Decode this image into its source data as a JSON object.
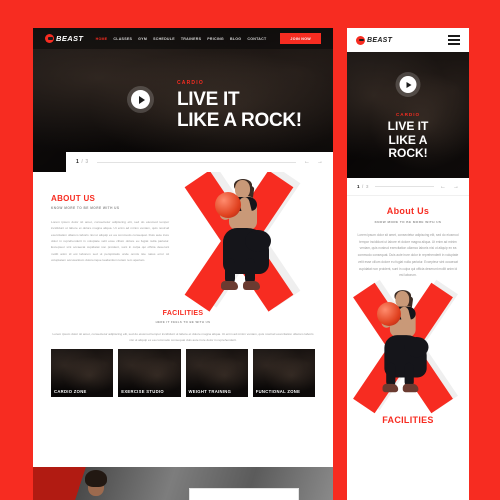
{
  "page": {
    "background_color": "#f72c21",
    "accent_color": "#f72c21",
    "brand": "BEAST"
  },
  "desktop": {
    "header": {
      "logo_text": "BEAST",
      "nav_items": [
        {
          "label": "HOME",
          "active": true
        },
        {
          "label": "CLASSES",
          "active": false
        },
        {
          "label": "GYM",
          "active": false
        },
        {
          "label": "SCHEDULE",
          "active": false
        },
        {
          "label": "TRAINERS",
          "active": false
        },
        {
          "label": "PRICING",
          "active": false
        },
        {
          "label": "BLOG",
          "active": false
        },
        {
          "label": "CONTACT",
          "active": false
        }
      ],
      "cta_label": "JOIN NOW"
    },
    "hero": {
      "kicker": "CARDIO",
      "headline_line1": "LIVE IT",
      "headline_line2": "LIKE A ROCK!",
      "play_icon": "play-icon"
    },
    "slider": {
      "current": "1",
      "separator": "/",
      "total": "3",
      "prev_icon": "arrow-left-icon",
      "next_icon": "arrow-right-icon"
    },
    "about": {
      "title": "ABOUT US",
      "subtitle": "KNOW MORE TO BE MORE WITH US",
      "body": "Lorem ipsum dolor sit amet, consectetur adipiscing elit, sed do eiusmod tempor incididunt ut labore et dolore magna aliqua. Ut enim ad minim veniam, quis nostrud exercitation ullamco laboris nisi ut aliquip ex ea commodo consequat. Duis aute irure dolor in reprehenderit in voluptate velit esse cillum dolore eu fugiat nulla pariatur. Excepteur sint occaecat cupidatat non proident, sunt in culpa qui officia deserunt mollit anim id est laborum sed ut perspiciatis unde omnis iste natus error sit voluptatem accusantium doloremque laudantium totam rem aperiam."
    },
    "facilities": {
      "title": "FACILITIES",
      "subtitle": "HERE IT FEELS TO BE WITH US",
      "body": "Lorem ipsum dolor sit amet, consectetur adipiscing elit, sed do eiusmod tempor incididunt ut labore et dolore magna aliqua. Ut enim ad minim veniam, quis nostrud exercitation ullamco laboris nisi ut aliquip ex ea commodo consequat duis aute irure dolor in reprehenderit.",
      "cards": [
        {
          "label": "CARDIO ZONE"
        },
        {
          "label": "EXERCISE STUDIO"
        },
        {
          "label": "WEIGHT TRAINING"
        },
        {
          "label": "FUNCTIONAL ZONE"
        }
      ]
    }
  },
  "mobile": {
    "header": {
      "logo_text": "BEAST",
      "menu_icon": "hamburger-menu-icon"
    },
    "hero": {
      "kicker": "CARDIO",
      "headline_line1": "LIVE IT",
      "headline_line2": "LIKE A",
      "headline_line3": "ROCK!",
      "play_icon": "play-icon"
    },
    "slider": {
      "current": "1",
      "separator": "/",
      "total": "3",
      "prev_icon": "arrow-left-icon",
      "next_icon": "arrow-right-icon"
    },
    "about": {
      "title": "About Us",
      "subtitle": "KNOW MORE TO BE MORE WITH US",
      "body": "Lorem ipsum dolor sit amet, consectetur adipiscing elit, sed do eiusmod tempor incididunt ut labore et dolore magna aliqua. Ut enim ad minim veniam, quis nostrud exercitation ullamco laboris nisi ut aliquip ex ea commodo consequat. Duis aute irure dolor in reprehenderit in voluptate velit esse cillum dolore eu fugiat nulla pariatur. Excepteur sint occaecat cupidatat non proident, sunt in culpa qui officia deserunt mollit anim id est laborum."
    },
    "facilities": {
      "title": "FACILITIES"
    }
  }
}
